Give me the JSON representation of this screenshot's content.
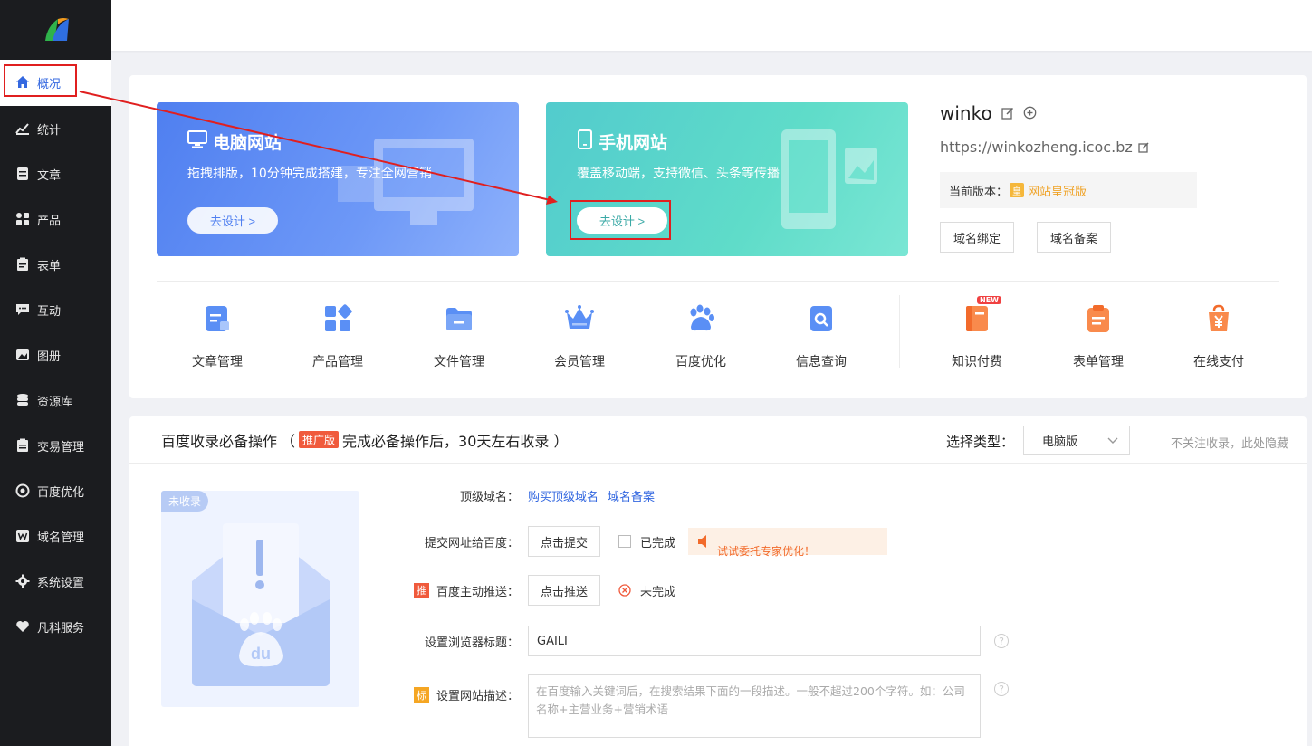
{
  "sidebar": {
    "items": [
      {
        "label": "概况",
        "icon": "home-icon"
      },
      {
        "label": "统计",
        "icon": "stats-icon"
      },
      {
        "label": "文章",
        "icon": "article-icon"
      },
      {
        "label": "产品",
        "icon": "grid-icon"
      },
      {
        "label": "表单",
        "icon": "form-icon"
      },
      {
        "label": "互动",
        "icon": "chat-icon"
      },
      {
        "label": "图册",
        "icon": "gallery-icon"
      },
      {
        "label": "资源库",
        "icon": "database-icon"
      },
      {
        "label": "交易管理",
        "icon": "trade-icon"
      },
      {
        "label": "百度优化",
        "icon": "target-icon"
      },
      {
        "label": "域名管理",
        "icon": "domain-icon"
      },
      {
        "label": "系统设置",
        "icon": "gear-icon"
      },
      {
        "label": "凡科服务",
        "icon": "heart-icon"
      }
    ]
  },
  "banners": {
    "pc": {
      "title": "电脑网站",
      "desc": "拖拽排版，10分钟完成搭建，专注全网营销",
      "button": "去设计 >"
    },
    "mobile": {
      "title": "手机网站",
      "desc": "覆盖移动端，支持微信、头条等传播",
      "button": "去设计 >"
    }
  },
  "site": {
    "name": "winko",
    "url": "https://winkozheng.icoc.bz",
    "version_label": "当前版本：",
    "version_badge": "皇",
    "version_name": "网站皇冠版",
    "bind_domain": "域名绑定",
    "record_domain": "域名备案"
  },
  "tools": [
    {
      "label": "文章管理",
      "icon": "article-manage-icon"
    },
    {
      "label": "产品管理",
      "icon": "product-manage-icon"
    },
    {
      "label": "文件管理",
      "icon": "file-manage-icon"
    },
    {
      "label": "会员管理",
      "icon": "crown-icon"
    },
    {
      "label": "百度优化",
      "icon": "paw-icon"
    },
    {
      "label": "信息查询",
      "icon": "search-doc-icon"
    },
    {
      "label": "知识付费",
      "icon": "book-icon",
      "badge": "NEW"
    },
    {
      "label": "表单管理",
      "icon": "clipboard-icon"
    },
    {
      "label": "在线支付",
      "icon": "yen-bag-icon"
    }
  ],
  "baidu": {
    "title": "百度收录必备操作",
    "tag": "推广版",
    "open_paren": "（",
    "sub": "完成必备操作后，30天左右收录 ）",
    "type_label": "选择类型：",
    "type_value": "电脑版",
    "ignore": "不关注收录，此处隐藏",
    "preview_tag": "未收录",
    "rows": {
      "domain_label": "顶级域名：",
      "buy_link": "购买顶级域名",
      "record_link": "域名备案",
      "submit_label": "提交网址给百度：",
      "submit_btn": "点击提交",
      "done_label": "已完成",
      "promo": "试试委托专家优化！",
      "push_tag": "推",
      "push_label": "百度主动推送：",
      "push_btn": "点击推送",
      "push_status": "未完成",
      "title_label": "设置浏览器标题：",
      "title_value": "GAILI",
      "desc_tag": "标",
      "desc_label": "设置网站描述：",
      "desc_placeholder": "在百度输入关键词后，在搜索结果下面的一段描述。一般不超过200个字符。如：公司名称+主营业务+营销术语",
      "help": "?"
    }
  },
  "colors": {
    "accent": "#3468e0",
    "sidebar": "#1b1c1f",
    "highlight": "#e01f1f"
  }
}
